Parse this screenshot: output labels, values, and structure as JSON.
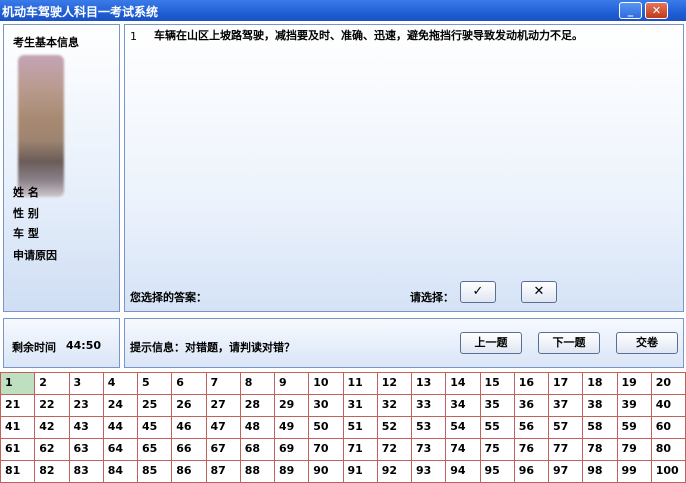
{
  "window": {
    "title": "机动车驾驶人科目一考试系统",
    "minimize_glyph": "_",
    "close_glyph": "✕"
  },
  "candidate": {
    "section_title": "考生基本信息",
    "labels": [
      "姓 名",
      "性 别",
      "车 型",
      "申请原因"
    ]
  },
  "question": {
    "number": "1",
    "text": "车辆在山区上坡路驾驶，减挡要及时、准确、迅速，避免拖挡行驶导致发动机动力不足。",
    "answer_label": "您选择的答案：",
    "choose_label": "请选择：",
    "true_glyph": "✓",
    "false_glyph": "✕"
  },
  "timer": {
    "label": "剩余时间",
    "value": "44:50"
  },
  "hint": {
    "text": "提示信息：对错题，请判读对错？"
  },
  "nav": {
    "prev": "上一题",
    "next": "下一题",
    "submit": "交卷"
  },
  "grid": {
    "current": 1,
    "count": 100
  },
  "colors": {
    "titlebar": "#1f5fd6",
    "grid_border": "#c0625a",
    "current_cell": "#bfe0c0"
  },
  "icons": {
    "minimize": "minimize-icon",
    "close": "close-icon",
    "true": "check-icon",
    "false": "cross-icon"
  }
}
